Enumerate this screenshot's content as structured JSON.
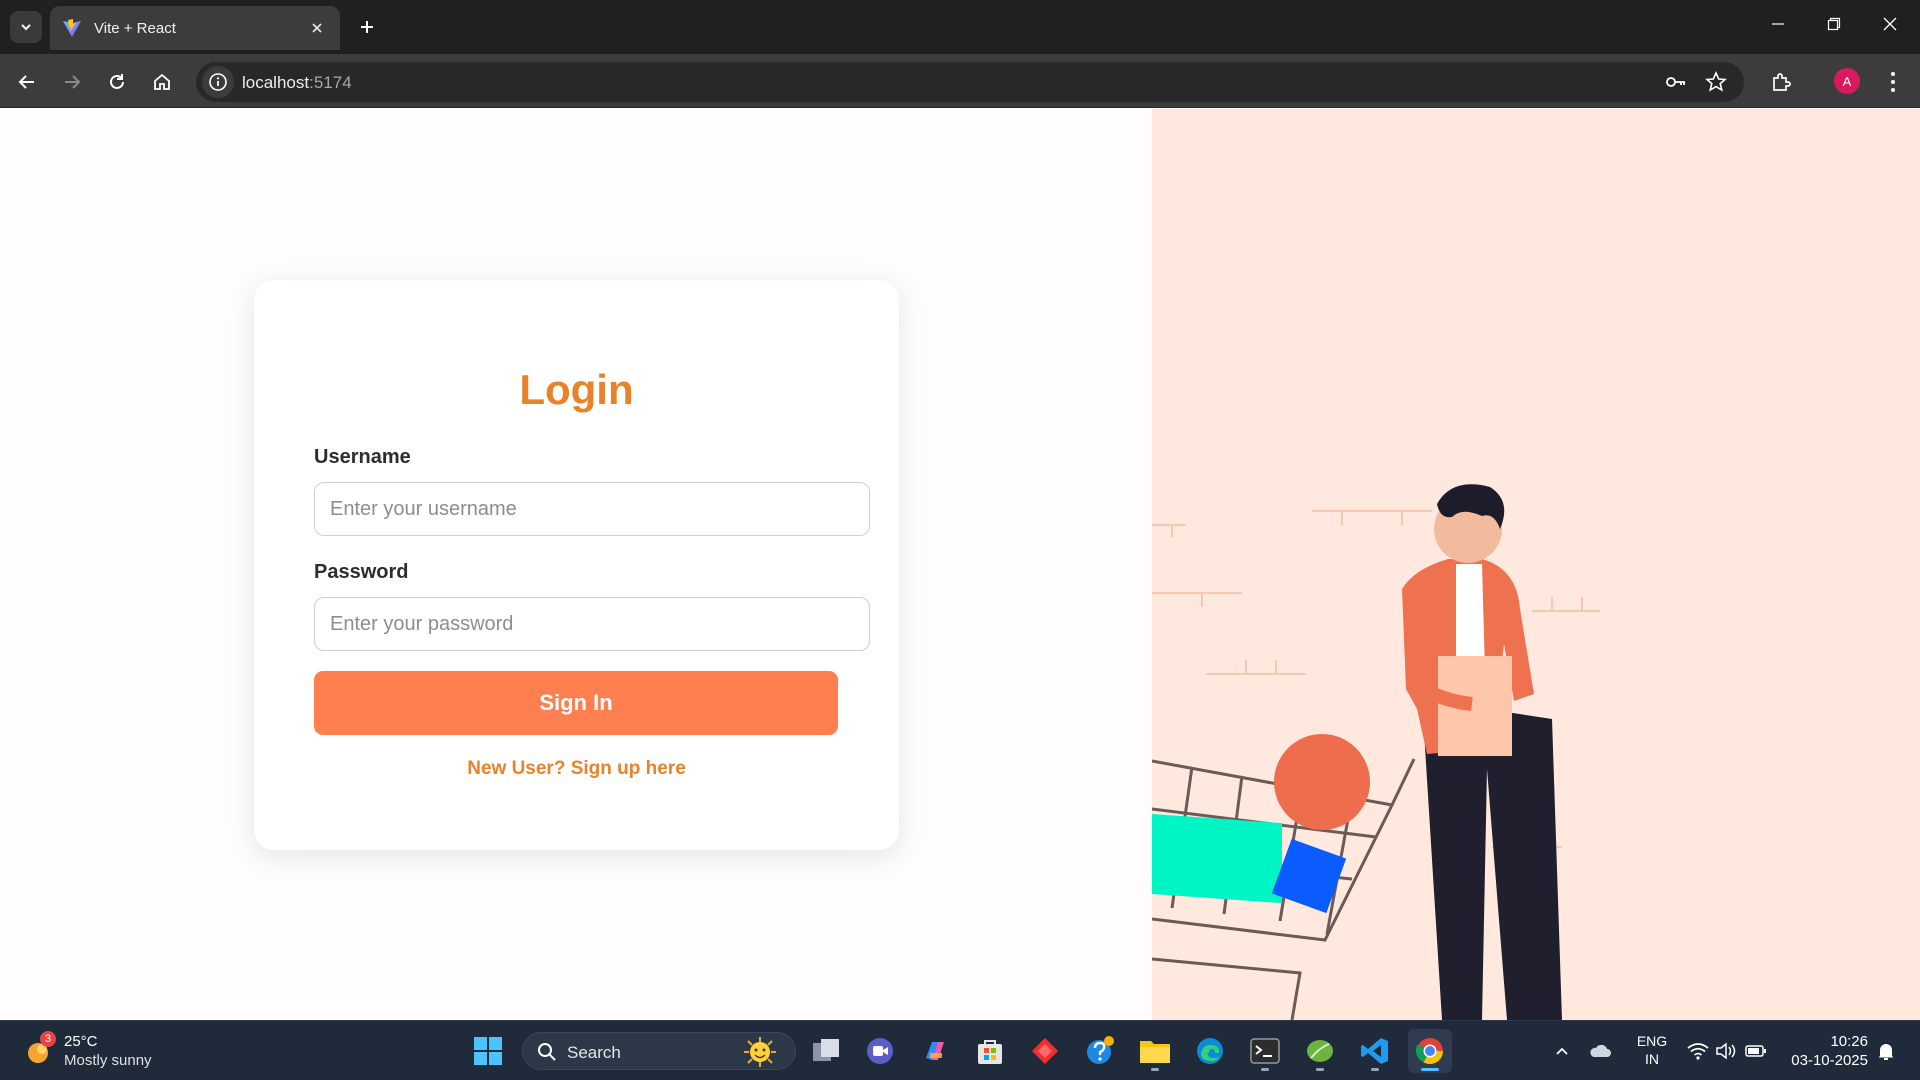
{
  "browser": {
    "tab_title": "Vite + React",
    "url_host": "localhost",
    "url_port": ":5174",
    "avatar_letter": "A"
  },
  "login": {
    "title": "Login",
    "username_label": "Username",
    "username_placeholder": "Enter your username",
    "password_label": "Password",
    "password_placeholder": "Enter your password",
    "signin_button": "Sign In",
    "signup_link": "New User? Sign up here"
  },
  "taskbar": {
    "weather_badge": "3",
    "temperature": "25°C",
    "weather_desc": "Mostly sunny",
    "search_label": "Search",
    "lang_line1": "ENG",
    "lang_line2": "IN",
    "time": "10:26",
    "date": "03-10-2025"
  },
  "colors": {
    "accent": "#e9832a",
    "button": "#ff7f50",
    "illustration_bg": "#ffe9df"
  }
}
